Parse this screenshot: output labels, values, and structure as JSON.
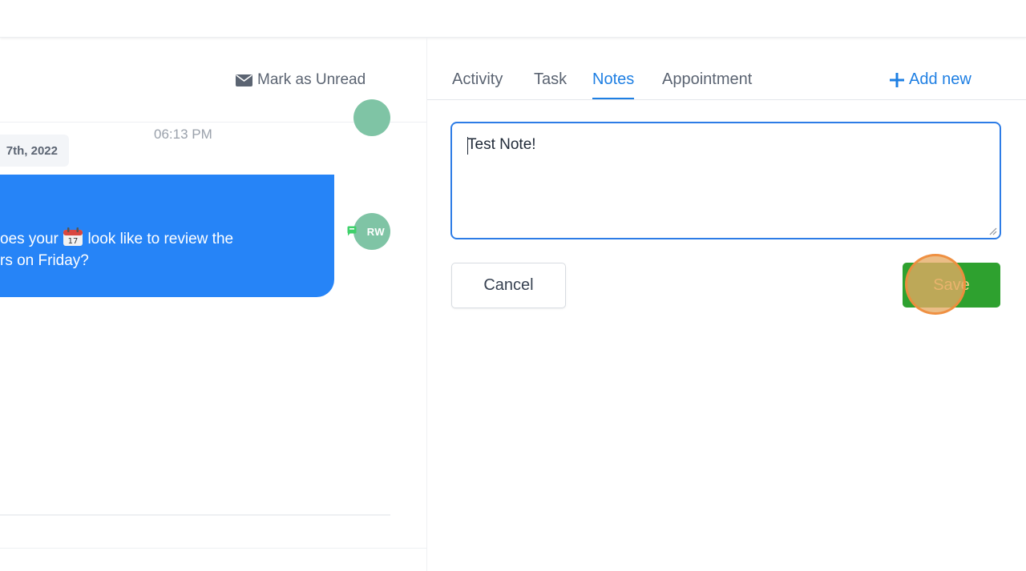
{
  "left_panel": {
    "mark_unread_label": "Mark as Unread",
    "message_time": "06:13 PM",
    "date_chip": "7th, 2022",
    "message_lines": [
      "",
      "oes your",
      "look like to review the",
      "rs on Friday?"
    ],
    "avatar_initials": "RW",
    "emoji": "calendar-emoji"
  },
  "right_panel": {
    "tabs": [
      {
        "label": "Activity"
      },
      {
        "label": "Task"
      },
      {
        "label": "Notes",
        "active": true
      },
      {
        "label": "Appointment"
      }
    ],
    "add_new_label": "Add new",
    "note_value": "Test Note!",
    "cancel_label": "Cancel",
    "save_label": "Save"
  },
  "colors": {
    "accent": "#1e7fe3",
    "bubble": "#2684f7",
    "save": "#2ea12f",
    "avatar": "#7fc4a5"
  }
}
